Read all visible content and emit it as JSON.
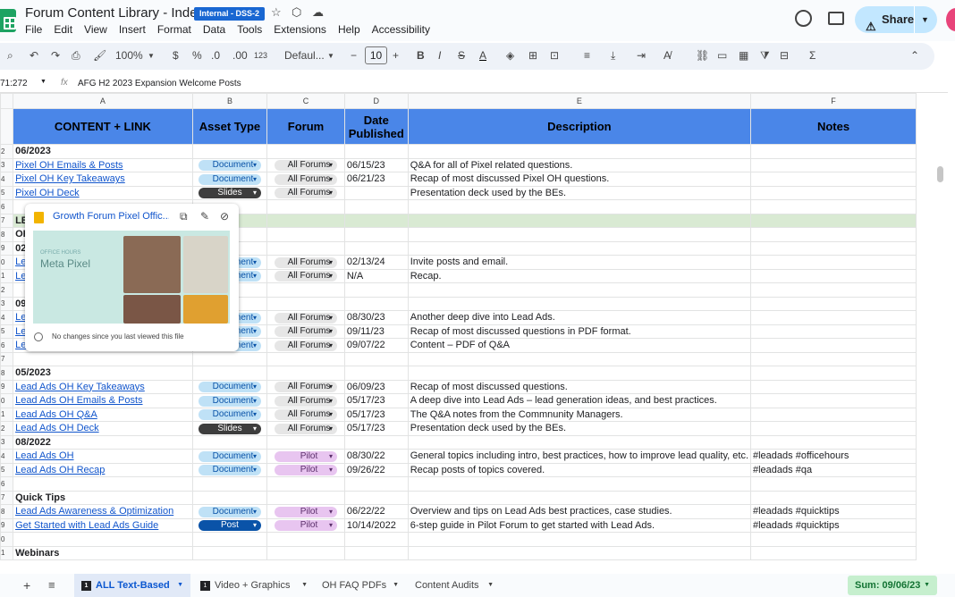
{
  "app": {
    "title": "Forum Content Library - Index",
    "badge": "Internal - DSS-2",
    "share": "Share"
  },
  "menu": [
    "File",
    "Edit",
    "View",
    "Insert",
    "Format",
    "Data",
    "Tools",
    "Extensions",
    "Help",
    "Accessibility"
  ],
  "toolbar": {
    "zoom": "100%",
    "currency": "$",
    "percent": "%",
    "dec_down": ".0",
    "dec_up": ".00",
    "number_format": "123",
    "font": "Defaul...",
    "font_size": "10",
    "minus": "−",
    "plus": "+"
  },
  "formula": {
    "cell": "71:272",
    "fx": "fx",
    "value": "AFG H2 2023 Expansion Welcome Posts"
  },
  "columns": [
    "A",
    "B",
    "C",
    "D",
    "E",
    "F"
  ],
  "header": {
    "a": "CONTENT + LINK",
    "b": "Asset Type",
    "c": "Forum",
    "d": "Date Published",
    "e": "Description",
    "f": "Notes"
  },
  "rows": [
    {
      "n": "2",
      "a": "06/2023",
      "sec": true
    },
    {
      "n": "3",
      "a": "Pixel OH Emails & Posts",
      "b": "Document",
      "c": "All Forums",
      "d": "06/15/23",
      "e": "Q&A for all of Pixel related questions."
    },
    {
      "n": "4",
      "a": "Pixel OH Key Takeaways",
      "b": "Document",
      "c": "All Forums",
      "d": "06/21/23",
      "e": "Recap of most discussed Pixel OH questions."
    },
    {
      "n": "5",
      "a": "Pixel OH Deck",
      "b": "Slides",
      "c": "All Forums",
      "e": "Presentation deck used by the BEs."
    },
    {
      "n": "6"
    },
    {
      "n": "7",
      "a": "LE",
      "green": true,
      "sec": true
    },
    {
      "n": "8",
      "a": "OH",
      "sec": true
    },
    {
      "n": "9",
      "a": "02",
      "sec": true
    },
    {
      "n": "0",
      "a": "Le",
      "b": "Document",
      "c": "All Forums",
      "d": "02/13/24",
      "e": "Invite posts and email."
    },
    {
      "n": "1",
      "a": "Le",
      "b": "Document",
      "c": "All Forums",
      "d": "N/A",
      "e": "Recap."
    },
    {
      "n": "2"
    },
    {
      "n": "3",
      "a": "09",
      "sec": true
    },
    {
      "n": "4",
      "a": "Le",
      "b": "Document",
      "c": "All Forums",
      "d": "08/30/23",
      "e": "Another deep dive into Lead Ads."
    },
    {
      "n": "5",
      "a": "Le",
      "b": "Document",
      "c": "All Forums",
      "d": "09/11/23",
      "e": "Recap of most discussed questions in PDF format."
    },
    {
      "n": "6",
      "a": "Le",
      "b": "Document",
      "c": "All Forums",
      "d": "09/07/22",
      "e": "Content – PDF of Q&A"
    },
    {
      "n": "7"
    },
    {
      "n": "8",
      "a": "05/2023",
      "sec": true
    },
    {
      "n": "9",
      "a": "Lead Ads OH Key Takeaways",
      "b": "Document",
      "c": "All Forums",
      "d": "06/09/23",
      "e": "Recap of most discussed questions."
    },
    {
      "n": "0",
      "a": "Lead Ads OH Emails & Posts",
      "b": "Document",
      "c": "All Forums",
      "d": "05/17/23",
      "e": "A deep dive into Lead Ads – lead generation ideas, and best practices."
    },
    {
      "n": "1",
      "a": "Lead Ads OH Q&A",
      "b": "Document",
      "c": "All Forums",
      "d": "05/17/23",
      "e": "The Q&A notes from the Commnunity Managers."
    },
    {
      "n": "2",
      "a": "Lead Ads OH Deck",
      "b": "Slides",
      "c": "All Forums",
      "d": "05/17/23",
      "e": "Presentation deck used by the BEs."
    },
    {
      "n": "3",
      "a": "08/2022",
      "sec": true
    },
    {
      "n": "4",
      "a": "Lead Ads OH ",
      "b": "Document",
      "c": "Pilot",
      "d": "08/30/22",
      "e": "General topics including intro, best practices, how to improve lead quality, etc.",
      "f": "#leadads #officehours"
    },
    {
      "n": "5",
      "a": "Lead Ads OH Recap",
      "b": "Document",
      "c": "Pilot",
      "d": "09/26/22",
      "e": "Recap posts of topics covered.",
      "f": "#leadads #qa"
    },
    {
      "n": "6"
    },
    {
      "n": "7",
      "a": "Quick Tips",
      "sec": true
    },
    {
      "n": "8",
      "a": "Lead Ads Awareness & Optimization",
      "b": "Document",
      "c": "Pilot",
      "d": "06/22/22",
      "e": "Overview and tips on Lead Ads best practices, case studies.",
      "f": "#leadads #quicktips"
    },
    {
      "n": "9",
      "a": "Get Started with Lead Ads Guide",
      "b": "Post",
      "c": "Pilot",
      "d": "10/14/2022",
      "e": "6-step guide in Pilot Forum to get started with Lead Ads.",
      "f": "#leadads #quicktips"
    },
    {
      "n": "0"
    },
    {
      "n": "1",
      "a": "Webinars",
      "sec": true
    }
  ],
  "popup": {
    "title": "Growth Forum Pixel Offic...",
    "thumb_small": "OFFICE HOURS",
    "thumb_big": "Meta Pixel",
    "status": "No changes since you last viewed this file"
  },
  "tabs": [
    {
      "num": "1",
      "label": "ALL Text-Based"
    },
    {
      "num": "1",
      "label": "Video + Graphics"
    },
    {
      "label": "OH FAQ PDFs"
    },
    {
      "label": "Content Audits"
    }
  ],
  "sum": "Sum: 09/06/23",
  "colors": {
    "header_bg": "#4a86e8",
    "doc_chip": "#bfe1f6",
    "pilot_chip": "#e8c5f0",
    "share": "#c2e7ff"
  }
}
